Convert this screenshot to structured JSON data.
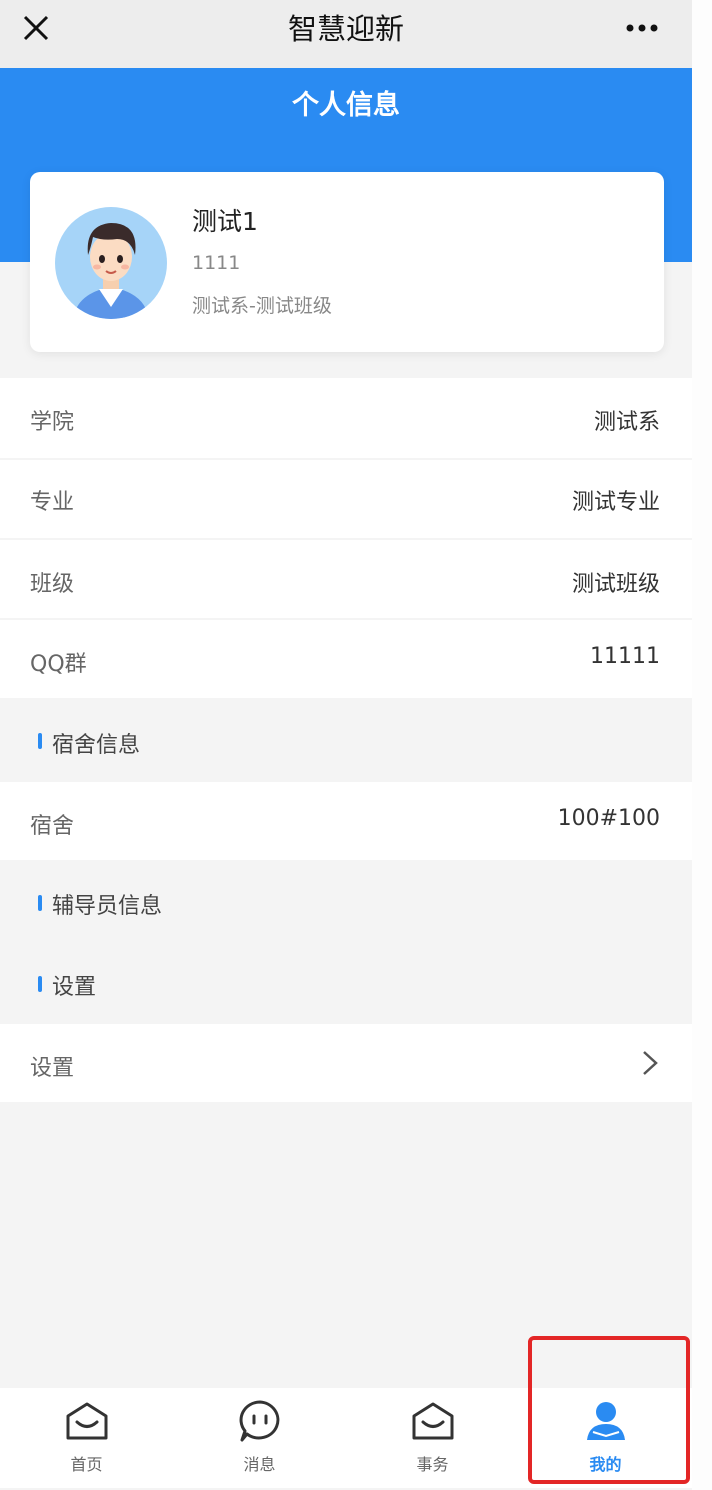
{
  "titlebar": {
    "title": "智慧迎新",
    "close_icon": "close-icon",
    "more_icon": "more-icon"
  },
  "header": {
    "title": "个人信息",
    "color": "#2a8bf2"
  },
  "profile": {
    "name": "测试1",
    "id": "1111",
    "dept": "测试系-测试班级",
    "avatar_icon": "avatar-icon"
  },
  "info_rows": [
    {
      "label": "学院",
      "value": "测试系"
    },
    {
      "label": "专业",
      "value": "测试专业"
    },
    {
      "label": "班级",
      "value": "测试班级"
    },
    {
      "label": "QQ群",
      "value": "11111"
    }
  ],
  "dorm_section": {
    "title": "宿舍信息",
    "row": {
      "label": "宿舍",
      "value": "100#100"
    }
  },
  "counselor_section": {
    "title": "辅导员信息"
  },
  "settings_section": {
    "title": "设置",
    "row": {
      "label": "设置",
      "icon": "chevron-right-icon"
    }
  },
  "tabs": [
    {
      "label": "首页",
      "icon": "home-icon",
      "active": false
    },
    {
      "label": "消息",
      "icon": "message-icon",
      "active": false
    },
    {
      "label": "事务",
      "icon": "affairs-icon",
      "active": false
    },
    {
      "label": "我的",
      "icon": "user-icon",
      "active": true
    }
  ],
  "highlight_color": "#e32626"
}
